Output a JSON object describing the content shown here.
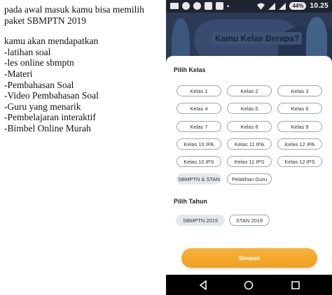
{
  "caption": {
    "line1": "pada awal masuk kamu bisa memilih",
    "line2": "paket SBMPTN 2019",
    "intro": "kamu akan mendapatkan",
    "items": [
      "-latihan soal",
      "-les online sbmptn",
      "-Materi",
      "-Pembahasan Soal",
      "-Video Pembahasan Soal",
      "-Guru yang  menarik",
      "-Pembelajaran interaktif",
      "-Bimbel Online Murah"
    ]
  },
  "status_bar": {
    "battery": "44%",
    "time": "10.25",
    "network": "LTE"
  },
  "header": {
    "title": "Kamu Kelas Berapa?"
  },
  "kelas": {
    "label": "Pilih Kelas",
    "options": [
      "Kelas 1",
      "Kelas 2",
      "Kelas 3",
      "Kelas 4",
      "Kelas 5",
      "Kelas 6",
      "Kelas 7",
      "Kelas 8",
      "Kelas 9",
      "Kelas 10 IPA",
      "Kelas 11 IPA",
      "Kelas 12 IPA",
      "Kelas 10 IPS",
      "Kelas 11 IPS",
      "Kelas 12 IPS",
      "SBMPTN & STAN",
      "Pelatihan Guru"
    ],
    "selected": "SBMPTN & STAN"
  },
  "tahun": {
    "label": "Pilih Tahun",
    "options": [
      "SBMPTN 2019",
      "STAN 2019"
    ],
    "selected": "SBMPTN 2019"
  },
  "actions": {
    "save_label": "Simpan"
  },
  "colors": {
    "accent": "#f5a623",
    "header_bg": "#2b3a57",
    "chip_selected": "#e4e8ee"
  }
}
